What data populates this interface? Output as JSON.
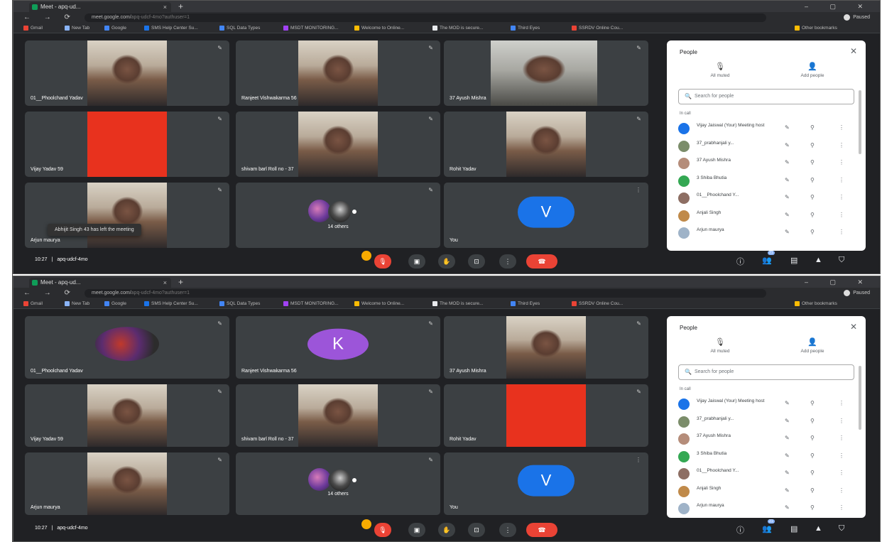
{
  "browser": {
    "tab_title": "Meet - apq-ud...",
    "tab_close": "×",
    "new_tab": "+",
    "window_controls": "– ▢ ✕",
    "nav": "← → ⟳",
    "url_host": "meet.google.com/",
    "url_rest": "apq-udcf-4mo?authuser=1",
    "profile_label": "Paused",
    "bookmarks": [
      {
        "label": "Gmail",
        "color": "#ea4335"
      },
      {
        "label": "New Tab",
        "color": "#8ab4f8"
      },
      {
        "label": "Google",
        "color": "#4285f4"
      },
      {
        "label": "SMS Help Center Su...",
        "color": "#1a73e8"
      },
      {
        "label": "SQL Data Types",
        "color": "#4285f4"
      },
      {
        "label": "MSDT MONITORING...",
        "color": "#a142f4"
      },
      {
        "label": "Welcome to Online...",
        "color": "#fbbc04"
      },
      {
        "label": "The MOD is secure...",
        "color": "#e8eaed"
      },
      {
        "label": "Third Eyes",
        "color": "#4285f4"
      },
      {
        "label": "SSRDV Online Cou...",
        "color": "#ea4335"
      },
      {
        "label": "Other bookmarks",
        "color": "#fbbc04"
      }
    ]
  },
  "screens": [
    {
      "tiles": [
        {
          "name": "01__Phoolchand Yadav",
          "kind": "photo"
        },
        {
          "name": "Ranjeet Vishwakarma 56",
          "kind": "photo"
        },
        {
          "name": "37 Ayush Mishra",
          "kind": "photo-dim"
        },
        {
          "name": "Vijay Yadav 59",
          "kind": "red"
        },
        {
          "name": "shivam barl Roll no - 37",
          "kind": "photo"
        },
        {
          "name": "Rohit Yadav",
          "kind": "photo"
        },
        {
          "name": "Arjun maurya",
          "kind": "photo"
        },
        {
          "name": "14 others",
          "kind": "others"
        },
        {
          "name": "You",
          "kind": "avatar-v",
          "initial": "V"
        }
      ],
      "toast": "Abhijit Singh 43 has left the meeting"
    },
    {
      "tiles": [
        {
          "name": "01__Phoolchand Yadav",
          "kind": "avatar-photo"
        },
        {
          "name": "Ranjeet Vishwakarma 56",
          "kind": "avatar-k",
          "initial": "K"
        },
        {
          "name": "37 Ayush Mishra",
          "kind": "photo"
        },
        {
          "name": "Vijay Yadav 59",
          "kind": "photo"
        },
        {
          "name": "shivam barl Roll no - 37",
          "kind": "photo"
        },
        {
          "name": "Rohit Yadav",
          "kind": "red"
        },
        {
          "name": "Arjun maurya",
          "kind": "photo"
        },
        {
          "name": "14 others",
          "kind": "others"
        },
        {
          "name": "You",
          "kind": "avatar-v",
          "initial": "V"
        }
      ],
      "toast": ""
    }
  ],
  "people_panel": {
    "title": "People",
    "close": "✕",
    "mute_all": "All muted",
    "add_people": "Add people",
    "search_placeholder": "Search for people",
    "section": "In call",
    "participants": [
      {
        "name": "Vijay Jaiswal (Your) Meeting host",
        "color": "#1a73e8"
      },
      {
        "name": "37_prabhanjali y...",
        "color": "#7b8d6a"
      },
      {
        "name": "37 Ayush Mishra",
        "color": "#b58d7a"
      },
      {
        "name": "3 Shiba Bhutia",
        "color": "#34a853"
      },
      {
        "name": "01__Phoolchand Y...",
        "color": "#8d6e63"
      },
      {
        "name": "Anjali Singh",
        "color": "#c08a4a"
      },
      {
        "name": "Arjun maurya",
        "color": "#9fb3c8"
      }
    ]
  },
  "controls": {
    "time": "10:27",
    "separator": "|",
    "meeting_code": "apq-udcf-4mo",
    "badge": "21"
  }
}
